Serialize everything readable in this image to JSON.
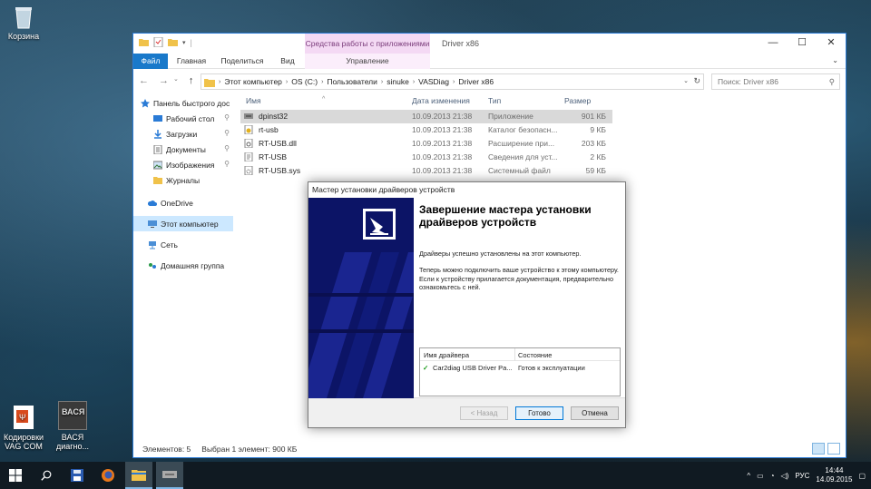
{
  "desktop": {
    "icons": [
      {
        "label": "Корзина"
      },
      {
        "label": "Кодировки VAG COM"
      },
      {
        "label": "ВАСЯ диагно..."
      }
    ]
  },
  "explorer": {
    "window_title": "Driver x86",
    "contextual_group": "Средства работы с приложениями",
    "ribbon_tabs": [
      "Файл",
      "Главная",
      "Поделиться",
      "Вид",
      "Управление"
    ],
    "breadcrumb": [
      "Этот компьютер",
      "OS (C:)",
      "Пользователи",
      "sinuke",
      "VASDiag",
      "Driver x86"
    ],
    "search_placeholder": "Поиск: Driver x86",
    "nav_items": [
      {
        "label": "Панель быстрого дос",
        "icon": "star-icon"
      },
      {
        "label": "Рабочий стол",
        "icon": "desktop-icon",
        "pinned": true
      },
      {
        "label": "Загрузки",
        "icon": "download-icon",
        "pinned": true
      },
      {
        "label": "Документы",
        "icon": "documents-icon",
        "pinned": true
      },
      {
        "label": "Изображения",
        "icon": "pictures-icon",
        "pinned": true
      },
      {
        "label": "Журналы",
        "icon": "folder-icon"
      },
      {
        "label": "OneDrive",
        "icon": "cloud-icon"
      },
      {
        "label": "Этот компьютер",
        "icon": "computer-icon",
        "selected": true
      },
      {
        "label": "Сеть",
        "icon": "network-icon"
      },
      {
        "label": "Домашняя группа",
        "icon": "homegroup-icon"
      }
    ],
    "columns": [
      "Имя",
      "Дата изменения",
      "Тип",
      "Размер"
    ],
    "files": [
      {
        "name": "dpinst32",
        "date": "10.09.2013 21:38",
        "type": "Приложение",
        "size": "901 КБ",
        "icon": "app-icon",
        "selected": true
      },
      {
        "name": "rt-usb",
        "date": "10.09.2013 21:38",
        "type": "Каталог безопасн...",
        "size": "9 КБ",
        "icon": "catalog-icon"
      },
      {
        "name": "RT-USB.dll",
        "date": "10.09.2013 21:38",
        "type": "Расширение при...",
        "size": "203 КБ",
        "icon": "dll-icon"
      },
      {
        "name": "RT-USB",
        "date": "10.09.2013 21:38",
        "type": "Сведения для уст...",
        "size": "2 КБ",
        "icon": "inf-icon"
      },
      {
        "name": "RT-USB.sys",
        "date": "10.09.2013 21:38",
        "type": "Системный файл",
        "size": "59 КБ",
        "icon": "sys-icon"
      }
    ],
    "status": {
      "count": "Элементов: 5",
      "selection": "Выбран 1 элемент: 900 КБ"
    }
  },
  "dialog": {
    "title": "Мастер установки драйверов устройств",
    "heading": "Завершение мастера установки драйверов устройств",
    "line1": "Драйверы успешно установлены на этот компьютер.",
    "line2": "Теперь можно подключить ваше устройство к этому компьютеру. Если к устройству прилагается документация, предварительно ознакомьтесь с ней.",
    "table": {
      "headers": [
        "Имя драйвера",
        "Состояние"
      ],
      "rows": [
        {
          "name": "Car2diag USB Driver Pa...",
          "status": "Готов к эксплуатации"
        }
      ]
    },
    "buttons": {
      "back": "< Назад",
      "finish": "Готово",
      "cancel": "Отмена"
    }
  },
  "taskbar": {
    "tray_lang": "РУС",
    "time": "14:44",
    "date": "14.09.2015"
  }
}
